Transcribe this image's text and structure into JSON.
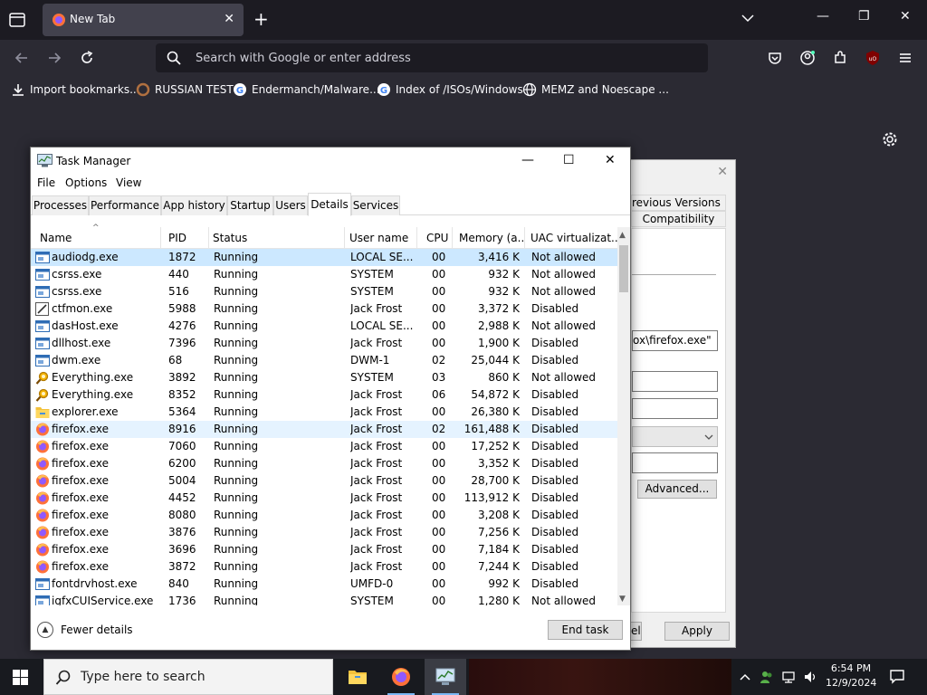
{
  "browser": {
    "tab_title": "New Tab",
    "url_placeholder": "Search with Google or enter address",
    "ublock_badge": "uO",
    "bookmarks": [
      {
        "label": "Import bookmarks...",
        "icon": "import-icon"
      },
      {
        "label": "RUSSIAN TEST",
        "icon": "ring-icon"
      },
      {
        "label": "Endermanch/Malware...",
        "icon": "google-icon"
      },
      {
        "label": "Index of /ISOs/Windows",
        "icon": "google-icon"
      },
      {
        "label": "MEMZ and Noescape ...",
        "icon": "globe-icon"
      }
    ]
  },
  "properties": {
    "tab_prev_versions": "revious Versions",
    "tab_compat": "Compatibility",
    "path_value": "ox\\firefox.exe\"",
    "advanced_label": "Advanced...",
    "cancel_fragment": "el",
    "apply_label": "Apply"
  },
  "task_manager": {
    "title": "Task Manager",
    "menu": [
      "File",
      "Options",
      "View"
    ],
    "tabs": [
      "Processes",
      "Performance",
      "App history",
      "Startup",
      "Users",
      "Details",
      "Services"
    ],
    "active_tab": "Details",
    "columns": [
      "Name",
      "PID",
      "Status",
      "User name",
      "CPU",
      "Memory (a...",
      "UAC virtualizat..."
    ],
    "rows": [
      {
        "name": "audiodg.exe",
        "pid": "1872",
        "status": "Running",
        "user": "LOCAL SE...",
        "cpu": "00",
        "mem": "3,416 K",
        "uac": "Not allowed",
        "icon": "exe"
      },
      {
        "name": "csrss.exe",
        "pid": "440",
        "status": "Running",
        "user": "SYSTEM",
        "cpu": "00",
        "mem": "932 K",
        "uac": "Not allowed",
        "icon": "exe"
      },
      {
        "name": "csrss.exe",
        "pid": "516",
        "status": "Running",
        "user": "SYSTEM",
        "cpu": "00",
        "mem": "932 K",
        "uac": "Not allowed",
        "icon": "exe"
      },
      {
        "name": "ctfmon.exe",
        "pid": "5988",
        "status": "Running",
        "user": "Jack Frost",
        "cpu": "00",
        "mem": "3,372 K",
        "uac": "Disabled",
        "icon": "pen"
      },
      {
        "name": "dasHost.exe",
        "pid": "4276",
        "status": "Running",
        "user": "LOCAL SE...",
        "cpu": "00",
        "mem": "2,988 K",
        "uac": "Not allowed",
        "icon": "exe"
      },
      {
        "name": "dllhost.exe",
        "pid": "7396",
        "status": "Running",
        "user": "Jack Frost",
        "cpu": "00",
        "mem": "1,900 K",
        "uac": "Disabled",
        "icon": "exe"
      },
      {
        "name": "dwm.exe",
        "pid": "68",
        "status": "Running",
        "user": "DWM-1",
        "cpu": "02",
        "mem": "25,044 K",
        "uac": "Disabled",
        "icon": "exe"
      },
      {
        "name": "Everything.exe",
        "pid": "3892",
        "status": "Running",
        "user": "SYSTEM",
        "cpu": "03",
        "mem": "860 K",
        "uac": "Not allowed",
        "icon": "magnifier"
      },
      {
        "name": "Everything.exe",
        "pid": "8352",
        "status": "Running",
        "user": "Jack Frost",
        "cpu": "06",
        "mem": "54,872 K",
        "uac": "Disabled",
        "icon": "magnifier"
      },
      {
        "name": "explorer.exe",
        "pid": "5364",
        "status": "Running",
        "user": "Jack Frost",
        "cpu": "00",
        "mem": "26,380 K",
        "uac": "Disabled",
        "icon": "folder"
      },
      {
        "name": "firefox.exe",
        "pid": "8916",
        "status": "Running",
        "user": "Jack Frost",
        "cpu": "02",
        "mem": "161,488 K",
        "uac": "Disabled",
        "icon": "firefox"
      },
      {
        "name": "firefox.exe",
        "pid": "7060",
        "status": "Running",
        "user": "Jack Frost",
        "cpu": "00",
        "mem": "17,252 K",
        "uac": "Disabled",
        "icon": "firefox"
      },
      {
        "name": "firefox.exe",
        "pid": "6200",
        "status": "Running",
        "user": "Jack Frost",
        "cpu": "00",
        "mem": "3,352 K",
        "uac": "Disabled",
        "icon": "firefox"
      },
      {
        "name": "firefox.exe",
        "pid": "5004",
        "status": "Running",
        "user": "Jack Frost",
        "cpu": "00",
        "mem": "28,700 K",
        "uac": "Disabled",
        "icon": "firefox"
      },
      {
        "name": "firefox.exe",
        "pid": "4452",
        "status": "Running",
        "user": "Jack Frost",
        "cpu": "00",
        "mem": "113,912 K",
        "uac": "Disabled",
        "icon": "firefox"
      },
      {
        "name": "firefox.exe",
        "pid": "8080",
        "status": "Running",
        "user": "Jack Frost",
        "cpu": "00",
        "mem": "3,208 K",
        "uac": "Disabled",
        "icon": "firefox"
      },
      {
        "name": "firefox.exe",
        "pid": "3876",
        "status": "Running",
        "user": "Jack Frost",
        "cpu": "00",
        "mem": "7,256 K",
        "uac": "Disabled",
        "icon": "firefox"
      },
      {
        "name": "firefox.exe",
        "pid": "3696",
        "status": "Running",
        "user": "Jack Frost",
        "cpu": "00",
        "mem": "7,184 K",
        "uac": "Disabled",
        "icon": "firefox"
      },
      {
        "name": "firefox.exe",
        "pid": "3872",
        "status": "Running",
        "user": "Jack Frost",
        "cpu": "00",
        "mem": "7,244 K",
        "uac": "Disabled",
        "icon": "firefox"
      },
      {
        "name": "fontdrvhost.exe",
        "pid": "840",
        "status": "Running",
        "user": "UMFD-0",
        "cpu": "00",
        "mem": "992 K",
        "uac": "Disabled",
        "icon": "exe"
      },
      {
        "name": "igfxCUIService.exe",
        "pid": "1736",
        "status": "Running",
        "user": "SYSTEM",
        "cpu": "00",
        "mem": "1,280 K",
        "uac": "Not allowed",
        "icon": "exe"
      }
    ],
    "fewer_details": "Fewer details",
    "end_task": "End task"
  },
  "taskbar": {
    "search_placeholder": "Type here to search",
    "time": "6:54 PM",
    "date": "12/9/2024"
  },
  "colors": {
    "selection": "#cce8ff",
    "hover": "#e5f3ff",
    "browser_dark": "#2b2a33",
    "accent": "#0060df"
  }
}
